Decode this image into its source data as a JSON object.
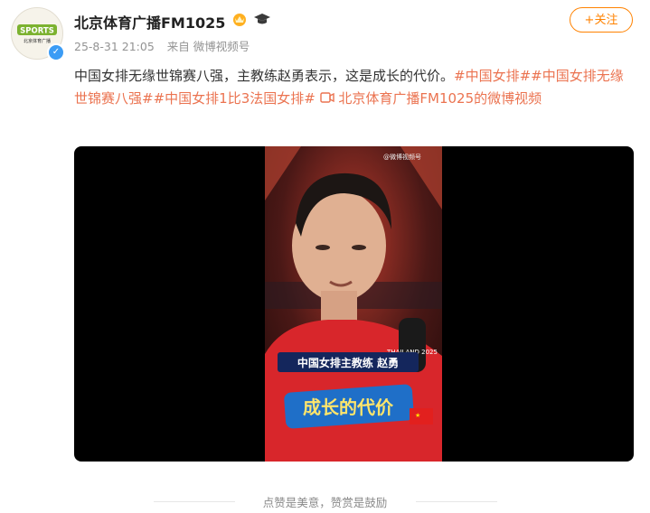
{
  "account": {
    "name": "北京体育广播FM1025",
    "avatar_text": "SPORTS",
    "avatar_sub": "北京体育广播"
  },
  "post": {
    "time": "25-8-31 21:05",
    "source": "来自 微博视频号",
    "follow_label": "+关注",
    "text": "中国女排无缘世锦赛八强，主教练赵勇表示，这是成长的代价。",
    "topics": [
      "#中国女排#",
      "#中国女排无缘世锦赛八强#",
      "#中国女排1比3法国女排#"
    ],
    "video_link": "北京体育广播FM1025的微博视频"
  },
  "video": {
    "watermark": "@微博视频号",
    "caption_name": "中国女排主教练 赵勇",
    "caption_title": "成长的代价",
    "mic_brand": "THAILAND 2025"
  },
  "footer": {
    "text": "点赞是美意，赞赏是鼓励"
  },
  "colors": {
    "accent": "#ff8200",
    "topic": "#eb7350",
    "meta": "#939393"
  }
}
